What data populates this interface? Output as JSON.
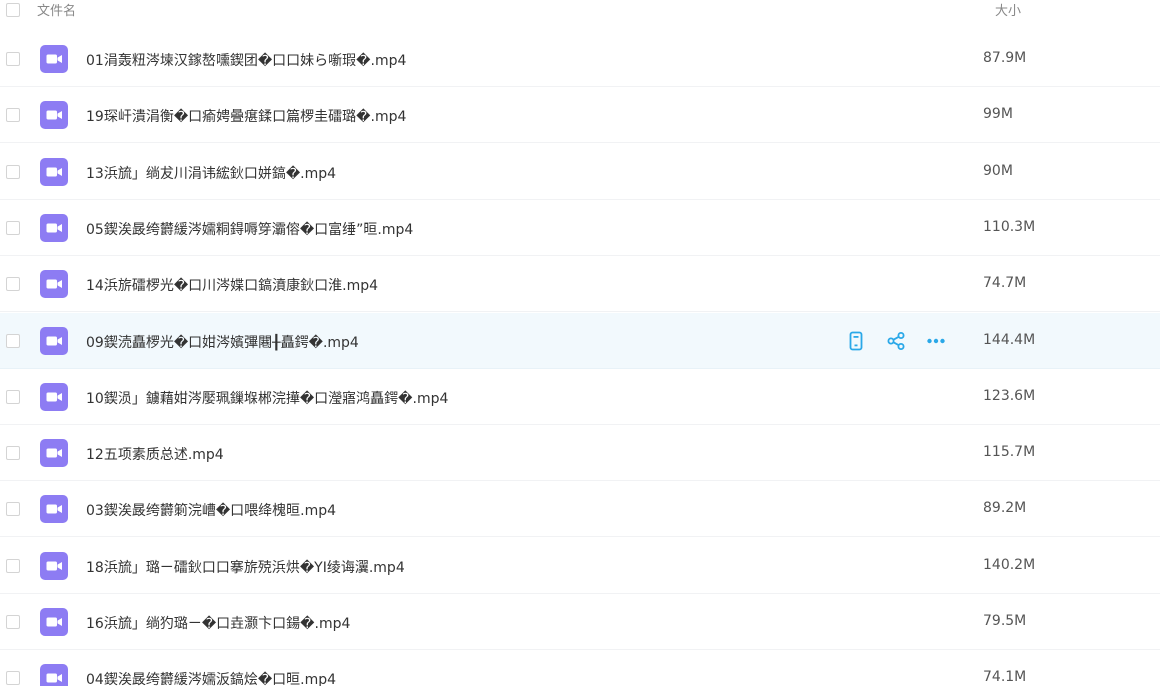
{
  "header": {
    "name_label": "文件名",
    "size_label": "大小"
  },
  "colors": {
    "video_icon": "#8d7cf3",
    "action_icon": "#2aa8e8",
    "hover_row": "#f2f9fd"
  },
  "files": [
    {
      "name": "01涓轰粈涔堜汉鎵嶅嚑鍥团�口口妹ら噺瑕�.mp4",
      "size": "87.9M"
    },
    {
      "name": "19琛屽潰涓衡�口瘉娉曡瘎鍒口篇椤圭礌璐�.mp4",
      "size": "99M"
    },
    {
      "name": "13浜旈」绱犮川涓讳綋鈥口姘鎬�.mp4",
      "size": "90M"
    },
    {
      "name": "05鍥涘晸绔欝緩涔嬬粡鍀嗕笌灞傛�口富缍”晅.mp4",
      "size": "110.3M"
    },
    {
      "name": "14浜旂礌椤光�口川涔媟口鎬濆康鈥口淮.mp4",
      "size": "74.7M"
    },
    {
      "name": "09鍥涜矗椤光�口姏涔嬪彃闀╂矗鍔�.mp4",
      "size": "144.4M",
      "hover": true
    },
    {
      "name": "10鍥涢」鐪藉姏涔嬮珮鏁堢郴浣撶�口瀅寤鸿矗鍔�.mp4",
      "size": "123.6M"
    },
    {
      "name": "12五项素质总述.mp4",
      "size": "115.7M"
    },
    {
      "name": "03鍥涘晸绔欝箣浣嶆�口喂绛槐晅.mp4",
      "size": "89.2M"
    },
    {
      "name": "18浜旈」璐ㄧ礌鈥口口搴旂殑浜烘�YI绫诲瀷.mp4",
      "size": "140.2M"
    },
    {
      "name": "16浜旈」绱犳璐ㄧ�口垚灏卞口鍚�.mp4",
      "size": "79.5M"
    },
    {
      "name": "04鍥涘晸绔欝緩涔嬬汳鎬烩�口晅.mp4",
      "size": "74.1M"
    }
  ],
  "row_actions": [
    {
      "icon": "phone-icon"
    },
    {
      "icon": "share-icon"
    },
    {
      "icon": "more-icon"
    }
  ]
}
